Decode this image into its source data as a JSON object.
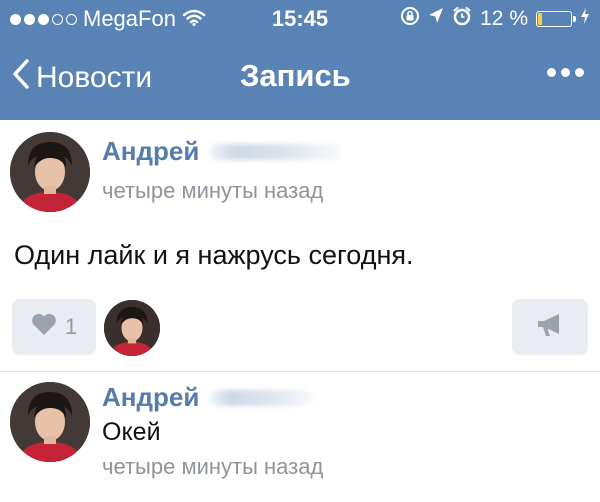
{
  "status_bar": {
    "carrier": "MegaFon",
    "time": "15:45",
    "battery_percent": "12 %",
    "battery_level": 0.12,
    "signal_bars_filled": 3,
    "signal_bars_total": 5
  },
  "nav": {
    "back_label": "Новости",
    "title": "Запись"
  },
  "post": {
    "author": "Андрей",
    "time": "четыре минуты назад",
    "text": "Один лайк и я нажрусь сегодня.",
    "likes_count": "1"
  },
  "comment": {
    "author": "Андрей",
    "text": "Окей",
    "time": "четыре минуты назад"
  },
  "colors": {
    "header_bg": "#5a83b5",
    "author_name": "#557cab",
    "meta_text": "#8f949c",
    "button_bg": "#e9ecf0"
  },
  "icons": {
    "back": "chevron-left-icon",
    "more": "more-dots-icon",
    "wifi": "wifi-icon",
    "rotation_lock": "rotation-lock-icon",
    "location": "location-arrow-icon",
    "alarm": "alarm-icon",
    "battery": "battery-icon",
    "charging": "charging-bolt-icon",
    "like": "heart-icon",
    "share": "megaphone-icon"
  }
}
